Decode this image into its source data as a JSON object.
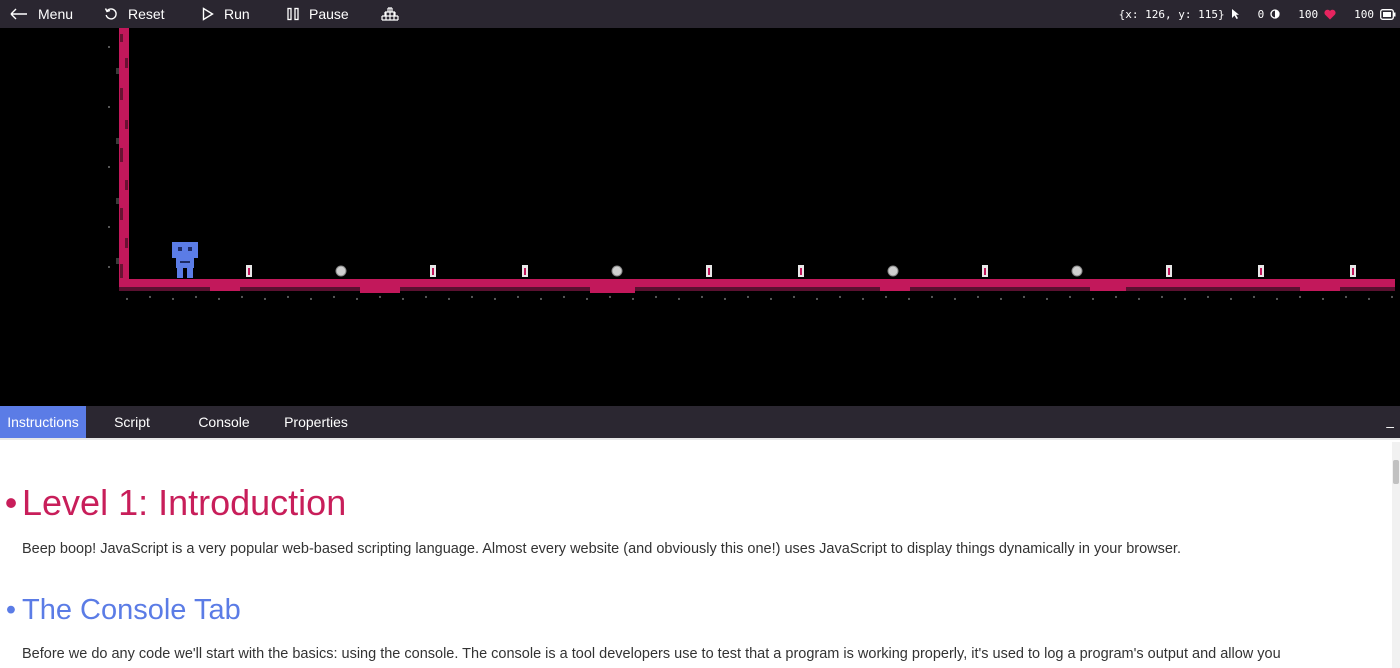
{
  "toolbar": {
    "menu_label": "Menu",
    "reset_label": "Reset",
    "run_label": "Run",
    "pause_label": "Pause",
    "grid_icon": "grid-icon"
  },
  "status": {
    "coords": "{x: 126, y: 115}",
    "clicks": "0",
    "health": "100",
    "energy": "100"
  },
  "tabs": [
    {
      "label": "Instructions",
      "active": true
    },
    {
      "label": "Script",
      "active": false
    },
    {
      "label": "Console",
      "active": false
    },
    {
      "label": "Properties",
      "active": false
    }
  ],
  "collapse_label": "–",
  "instructions": {
    "heading1": "Level 1: Introduction",
    "para1": "Beep boop! JavaScript is a very popular web-based scripting language. Almost every website (and obviously this one!) uses JavaScript to display things dynamically in your browser.",
    "heading2": "The Console Tab",
    "para2": "Before we do any code we'll start with the basics: using the console. The console is a tool developers use to test that a program is working properly, it's used to log a program's output and allow you"
  },
  "colors": {
    "accent_blue": "#5b7ce6",
    "accent_red": "#c81e5a",
    "toolbar_bg": "#2a2630"
  },
  "game": {
    "items": [
      "vial",
      "coin",
      "vial",
      "vial",
      "coin",
      "vial",
      "vial",
      "coin",
      "vial",
      "coin",
      "vial",
      "vial",
      "vial"
    ]
  }
}
